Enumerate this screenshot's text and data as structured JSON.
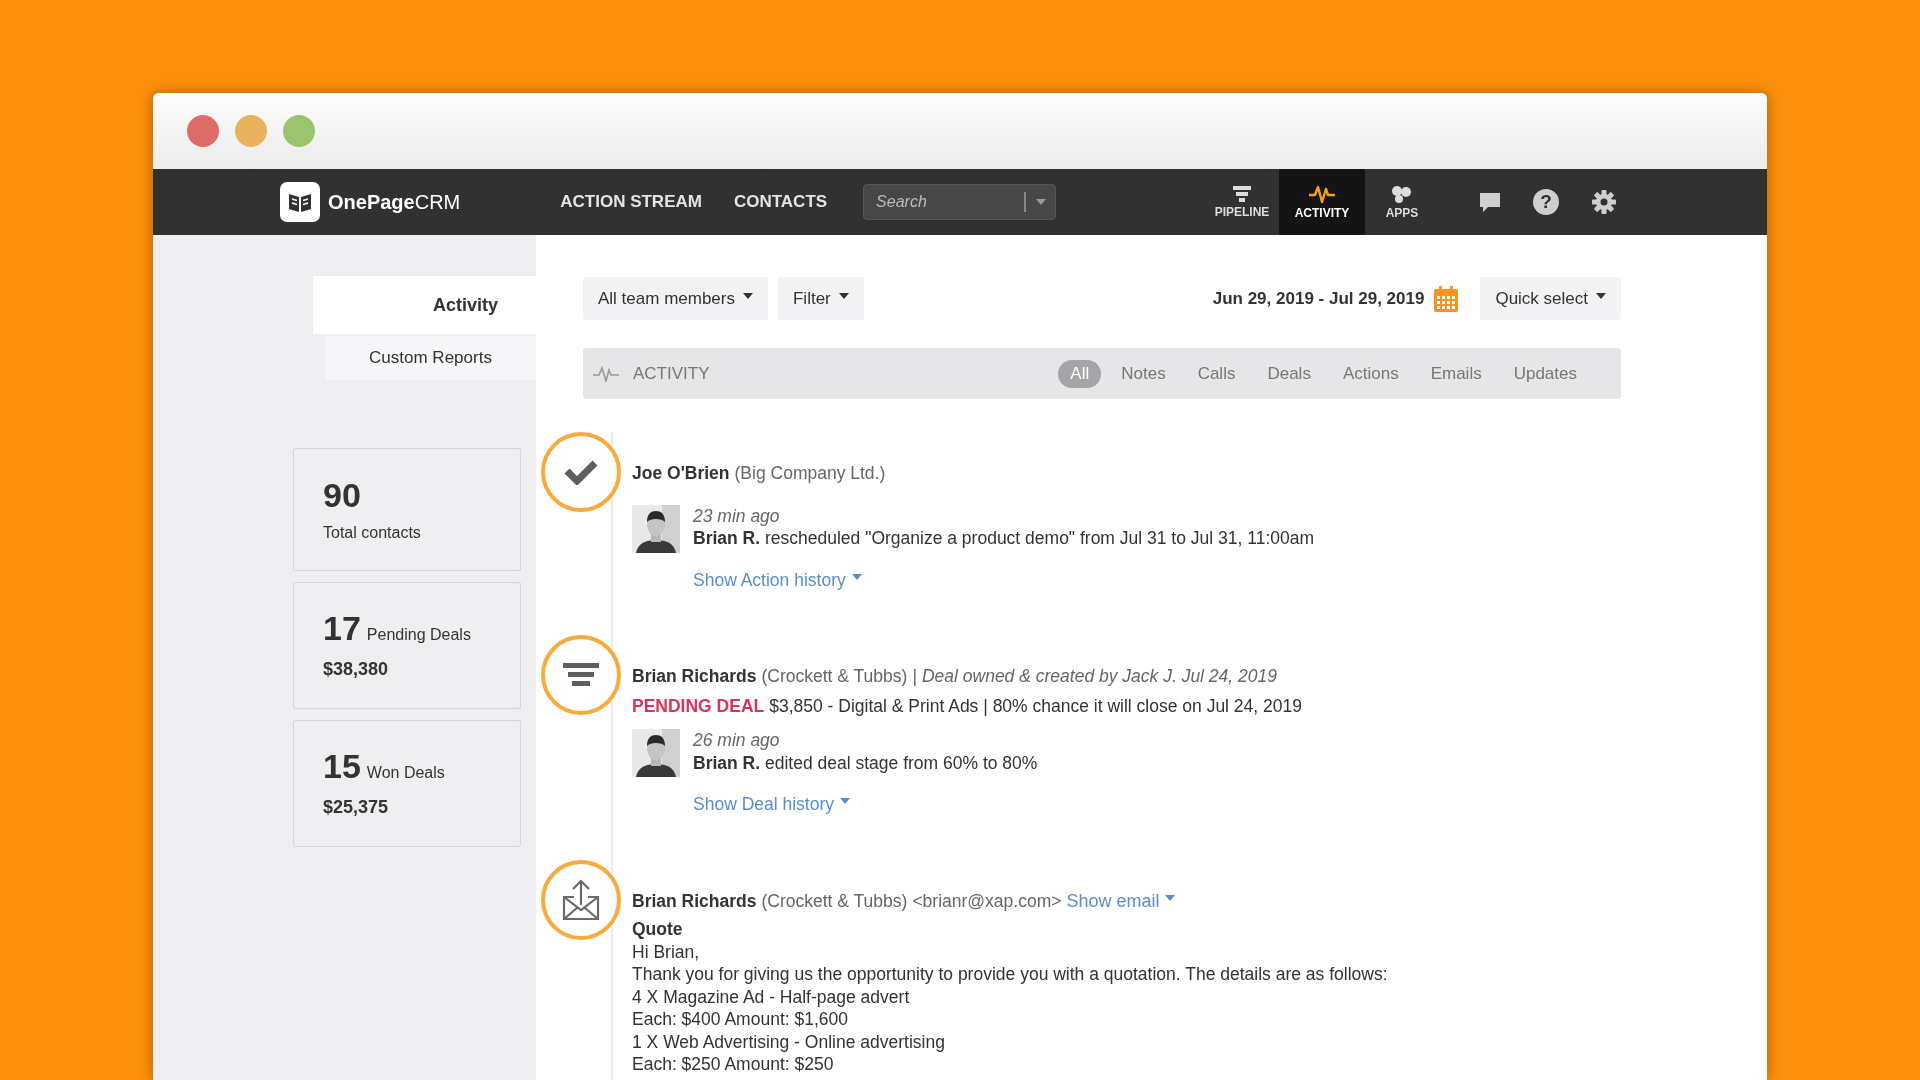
{
  "nav": {
    "logo": "**OnePage**CRM",
    "links": [
      {
        "label": "ACTION STREAM",
        "selected": false
      },
      {
        "label": "CONTACTS",
        "selected": false
      }
    ],
    "search": {
      "placeholder": "Search"
    },
    "tabs": [
      {
        "kind": "pipeline",
        "label": "PIPELINE",
        "selected": false
      },
      {
        "kind": "activity",
        "label": "ACTIVITY",
        "selected": true
      },
      {
        "kind": "apps",
        "label": "APPS",
        "selected": false
      }
    ],
    "help_glyph": "?"
  },
  "sidebar": {
    "tabs": [
      {
        "label": "Activity",
        "selected": true
      },
      {
        "label": "Custom Reports",
        "selected": false
      }
    ],
    "stats": [
      {
        "kind": "count",
        "value": "90",
        "label": "Total contacts"
      },
      {
        "kind": "deals",
        "value": "17",
        "label": "Pending Deals",
        "amount": "$38,380"
      },
      {
        "kind": "deals",
        "value": "15",
        "label": "Won Deals",
        "amount": "$25,375"
      }
    ]
  },
  "toolbar": {
    "team": "All team members",
    "filter": "Filter",
    "date_range": "Jun 29, 2019 - Jul 29, 2019",
    "quick_select": "Quick select"
  },
  "activity_bar": {
    "title": "ACTIVITY",
    "filters": [
      {
        "label": "All",
        "selected": true
      },
      {
        "label": "Notes",
        "selected": false
      },
      {
        "label": "Calls",
        "selected": false
      },
      {
        "label": "Deals",
        "selected": false
      },
      {
        "label": "Actions",
        "selected": false
      },
      {
        "label": "Emails",
        "selected": false
      },
      {
        "label": "Updates",
        "selected": false
      }
    ]
  },
  "feed": [
    {
      "kind": "action",
      "name": "Joe O'Brien",
      "company": "(Big Company Ltd.)",
      "time": "23 min ago",
      "author": "Brian R.",
      "message": "rescheduled \"Organize a product demo\" from Jul 31 to Jul 31, 11:00am",
      "history_link": "Show Action history"
    },
    {
      "kind": "deal",
      "name": "Brian Richards",
      "company": "(Crockett & Tubbs)",
      "separator": "|",
      "note": "Deal owned & created by Jack J. Jul 24, 2019",
      "deal_status": "PENDING DEAL",
      "deal_text": "$3,850 - Digital & Print Ads | 80% chance it will close on Jul 24, 2019",
      "time": "26 min ago",
      "author": "Brian R.",
      "message": "edited deal stage from 60% to 80%",
      "history_link": "Show Deal history"
    },
    {
      "kind": "email",
      "name": "Brian Richards",
      "company": "(Crockett & Tubbs)",
      "email": "<brianr@xap.com>",
      "show_email": "Show email",
      "subject": "Quote",
      "body": [
        "Hi Brian,",
        "Thank you for giving us the opportunity to provide you with a quotation. The details are as follows:",
        "4 X Magazine Ad - Half-page advert",
        "Each: $400 Amount: $1,600",
        "1 X Web Advertising - Online advertising",
        "Each: $250 Amount: $250"
      ]
    }
  ]
}
